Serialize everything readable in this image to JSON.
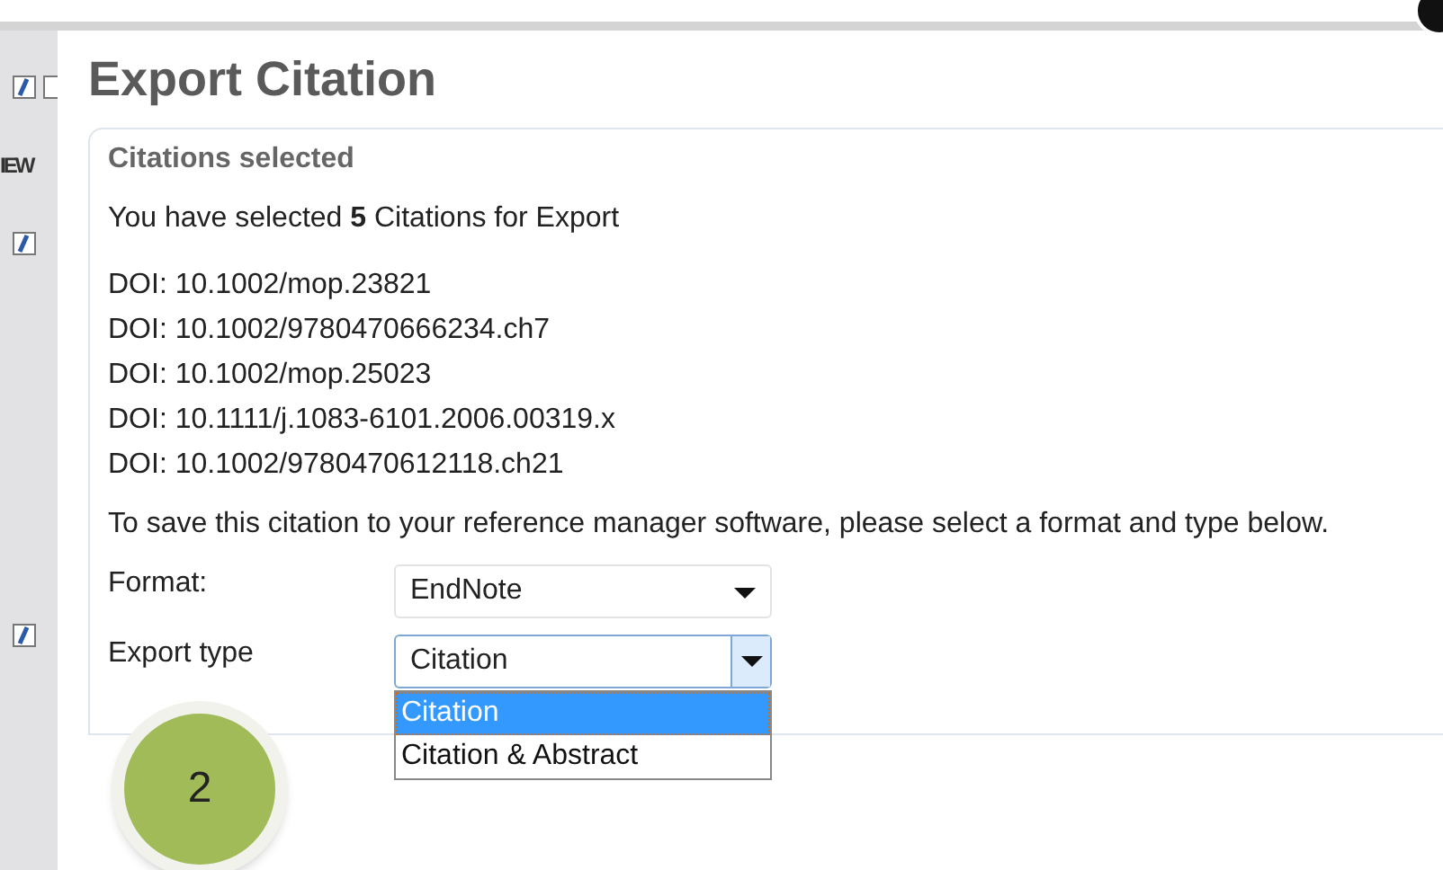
{
  "sidebar": {
    "checkboxes": [
      {
        "checked": true
      },
      {
        "checked": false
      },
      {
        "checked": true
      },
      {
        "checked": true
      }
    ],
    "label": "IEW"
  },
  "dialog": {
    "title": "Export Citation",
    "section": {
      "heading": "Citations selected",
      "summary": "You have selected **5** Citations for Export",
      "dois": [
        "DOI: 10.1002/mop.23821",
        "DOI: 10.1002/9780470666234.ch7",
        "DOI: 10.1002/mop.25023",
        "DOI: 10.1111/j.1083-6101.2006.00319.x",
        "DOI: 10.1002/9780470612118.ch21"
      ],
      "instructions": "To save this citation to your reference manager software, please select a format and type below.",
      "format": {
        "label": "Format:",
        "value": "EndNote",
        "open": false
      },
      "export_type": {
        "label": "Export type",
        "value": "Citation",
        "open": true,
        "options": [
          {
            "label": "Citation",
            "selected": true
          },
          {
            "label": "Citation & Abstract",
            "selected": false
          }
        ]
      }
    }
  },
  "annotation": {
    "step": "2"
  }
}
